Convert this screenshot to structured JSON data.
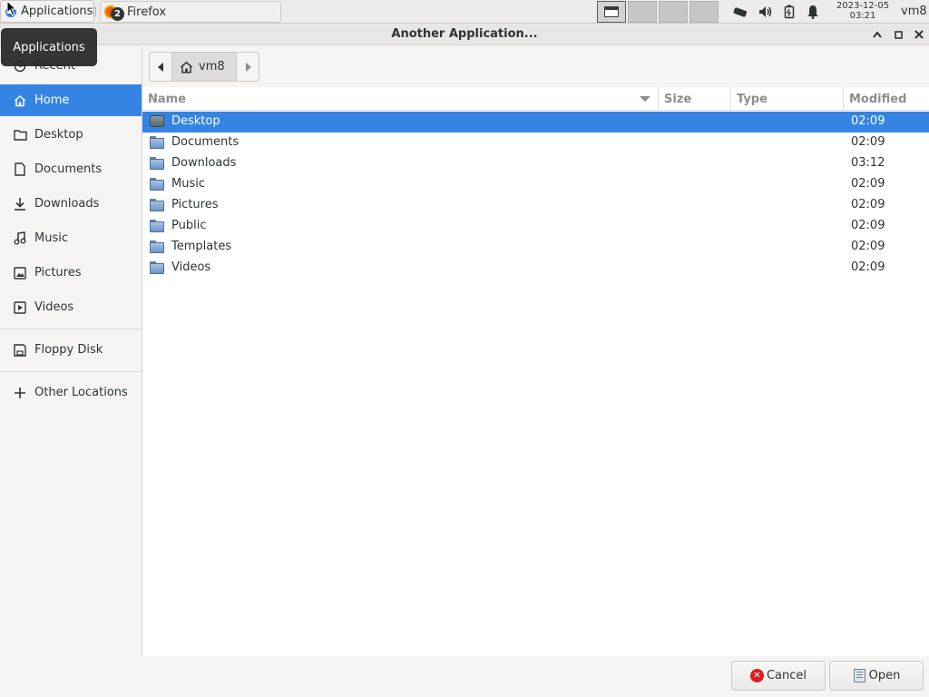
{
  "panel": {
    "applications_label": "Applications",
    "task_label": "Firefox",
    "task_badge": "2",
    "clock_date": "2023-12-05",
    "clock_time": "03:21",
    "user": "vm8"
  },
  "tooltip": {
    "text": "Applications"
  },
  "dialog": {
    "title": "Another Application..."
  },
  "sidebar": {
    "items": [
      {
        "label": "Recent",
        "icon": "clock-icon"
      },
      {
        "label": "Home",
        "icon": "home-icon"
      },
      {
        "label": "Desktop",
        "icon": "folder-icon"
      },
      {
        "label": "Documents",
        "icon": "document-icon"
      },
      {
        "label": "Downloads",
        "icon": "download-icon"
      },
      {
        "label": "Music",
        "icon": "music-icon"
      },
      {
        "label": "Pictures",
        "icon": "picture-icon"
      },
      {
        "label": "Videos",
        "icon": "video-icon"
      },
      {
        "label": "Floppy Disk",
        "icon": "floppy-icon"
      },
      {
        "label": "Other Locations",
        "icon": "plus-icon"
      }
    ],
    "selected": "Home"
  },
  "pathbar": {
    "current": "vm8"
  },
  "columns": {
    "name": "Name",
    "size": "Size",
    "type": "Type",
    "modified": "Modified"
  },
  "files": [
    {
      "name": "Desktop",
      "modified": "02:09"
    },
    {
      "name": "Documents",
      "modified": "02:09"
    },
    {
      "name": "Downloads",
      "modified": "03:12"
    },
    {
      "name": "Music",
      "modified": "02:09"
    },
    {
      "name": "Pictures",
      "modified": "02:09"
    },
    {
      "name": "Public",
      "modified": "02:09"
    },
    {
      "name": "Templates",
      "modified": "02:09"
    },
    {
      "name": "Videos",
      "modified": "02:09"
    }
  ],
  "buttons": {
    "cancel": "Cancel",
    "open": "Open"
  },
  "colors": {
    "accent": "#3584e4",
    "cancel_icon": "#e01b24"
  }
}
